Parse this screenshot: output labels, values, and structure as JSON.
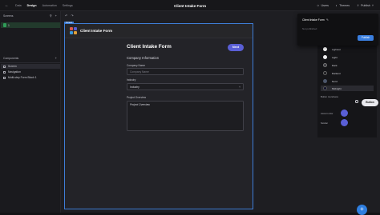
{
  "topbar": {
    "nav": [
      "Data",
      "Design",
      "Automation",
      "Settings"
    ],
    "active_nav": "Design",
    "title": "Client Intake Form",
    "users": "Users",
    "themes": "Themes",
    "publish": "Publish"
  },
  "left_panel": {
    "screens_heading": "Screens",
    "screen_item": "1",
    "components_heading": "Components",
    "components": [
      "Screen",
      "Navigation",
      "Multi-step Form Block 1"
    ]
  },
  "frame": {
    "tag": "Screen",
    "app_title": "Client Intake Form",
    "logo_colors": [
      "#e0584c",
      "#5a5fd6",
      "#3a9be0",
      "#e0a03a"
    ]
  },
  "form": {
    "title": "Client Intake Form",
    "next_button": "Next",
    "section_heading": "Company Information",
    "fields": {
      "company_name": {
        "label": "Company Name",
        "placeholder": "Company Name"
      },
      "industry": {
        "label": "Industry",
        "value": "Industry"
      },
      "project_overview": {
        "label": "Project Overview",
        "value": "Project Overview"
      }
    },
    "fab": "+"
  },
  "publish_popover": {
    "title": "Client Intake Form",
    "description": "Not published",
    "button": "Publish"
  },
  "themes_panel": {
    "themes": [
      {
        "name": "Lightest",
        "color": "#ffffff"
      },
      {
        "name": "Light",
        "color": "#f0f0f2"
      },
      {
        "name": "Dark",
        "color": "#3a3a40"
      },
      {
        "name": "Darkest",
        "color": "#1a1a1e"
      },
      {
        "name": "Nord",
        "color": "#4c566a"
      },
      {
        "name": "Midnight",
        "color": "#0e0f2a"
      }
    ],
    "selected": "Midnight",
    "button_roundness_label": "Button roundness",
    "preview_button": "Button",
    "accent_color_label": "Accent color",
    "accent_color": "#5a5fd6",
    "navbar_label": "Navbar",
    "navbar_color": "#5a5fd6"
  },
  "colors": {
    "selection_blue": "#3e7dd6",
    "accent": "#5a5fd6",
    "fab": "#2f7fe0"
  }
}
